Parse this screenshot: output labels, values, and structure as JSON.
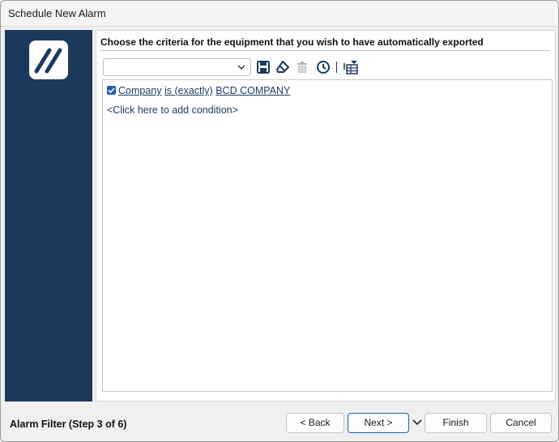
{
  "window": {
    "title": "Schedule New Alarm"
  },
  "content": {
    "heading": "Choose the criteria for the equipment that you wish to have automatically exported"
  },
  "filter": {
    "combo_value": "",
    "condition": {
      "checked": true,
      "field": "Company",
      "operator": "is (exactly)",
      "value": "BCD COMPANY"
    },
    "add_condition": "<Click here to add condition>"
  },
  "toolbar": {
    "icons": [
      "save-icon",
      "eraser-icon",
      "trash-icon",
      "clock-icon",
      "filter-table-icon"
    ]
  },
  "footer": {
    "step_label": "Alarm Filter (Step 3 of 6)",
    "back_label": "<  Back",
    "next_label": "Next  >",
    "finish_label": "Finish",
    "cancel_label": "Cancel"
  },
  "colors": {
    "side_panel": "#1b3a5c",
    "accent": "#1d5fb4"
  }
}
